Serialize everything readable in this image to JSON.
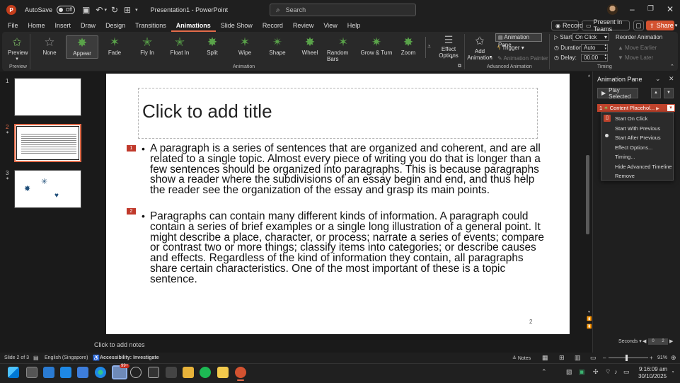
{
  "titlebar": {
    "autosave_label": "AutoSave",
    "autosave_state": "Off",
    "doc_title": "Presentation1  -  PowerPoint",
    "search_placeholder": "Search"
  },
  "menu": {
    "tabs": [
      "File",
      "Home",
      "Insert",
      "Draw",
      "Design",
      "Transitions",
      "Animations",
      "Slide Show",
      "Record",
      "Review",
      "View",
      "Help"
    ],
    "active_tab": "Animations",
    "record_label": "Record",
    "present_teams_label": "Present in Teams",
    "share_label": "Share"
  },
  "ribbon": {
    "preview_label": "Preview",
    "preview_group": "Preview",
    "animations": [
      "None",
      "Appear",
      "Fade",
      "Fly In",
      "Float In",
      "Split",
      "Wipe",
      "Shape",
      "Wheel",
      "Random Bars",
      "Grow & Turn",
      "Zoom"
    ],
    "selected_animation": "Appear",
    "effect_options": [
      "Effect",
      "Options"
    ],
    "animation_group": "Animation",
    "add_animation": [
      "Add",
      "Animation"
    ],
    "animation_pane_btn": "Animation Pane",
    "trigger_btn": "Trigger",
    "animation_painter": "Animation Painter",
    "advanced_group": "Advanced Animation",
    "start_label": "Start:",
    "start_value": "On Click",
    "duration_label": "Duration:",
    "duration_value": "Auto",
    "delay_label": "Delay:",
    "delay_value": "00.00",
    "timing_group": "Timing",
    "reorder_label": "Reorder Animation",
    "move_earlier": "Move Earlier",
    "move_later": "Move Later"
  },
  "slides": [
    {
      "num": "1"
    },
    {
      "num": "2"
    },
    {
      "num": "3"
    }
  ],
  "slide": {
    "title_placeholder": "Click to add title",
    "tags": [
      "1",
      "2"
    ],
    "para1": "A paragraph is a series of sentences that are organized and coherent, and are all related to a single topic. Almost every piece of writing you do that is longer than a few sentences should be organized into paragraphs. This is because paragraphs show a reader where the subdivisions of an essay begin and end, and thus help the reader see the organization of the essay and grasp its main points.",
    "para2": "Paragraphs can contain many different kinds of information. A paragraph could contain a series of brief examples or a single long illustration of a general point. It might describe a place, character, or process; narrate a series of events; compare or contrast two or more things; classify items into categories; or describe causes and effects. Regardless of the kind of information they contain, all paragraphs share certain characteristics. One of the most important of these is a topic sentence.",
    "page_number": "2"
  },
  "animation_pane": {
    "title": "Animation Pane",
    "play_selected": "Play Selected",
    "item_label": "Content Placehol...",
    "item_index": "1",
    "context_menu": [
      "Start On Click",
      "Start With Previous",
      "Start After Previous",
      "Effect Options...",
      "Timing...",
      "Hide Advanced Timeline",
      "Remove"
    ],
    "seconds_label": "Seconds",
    "timeline_values": [
      "0",
      "2"
    ]
  },
  "notes": {
    "placeholder": "Click to add notes"
  },
  "status": {
    "slide_info": "Slide 2 of 3",
    "language": "English (Singapore)",
    "accessibility": "Accessibility: Investigate",
    "notes_btn": "Notes",
    "zoom": "91%"
  },
  "taskbar": {
    "time": "9:16:09 am",
    "date": "30/10/2025",
    "badge": "99+"
  }
}
